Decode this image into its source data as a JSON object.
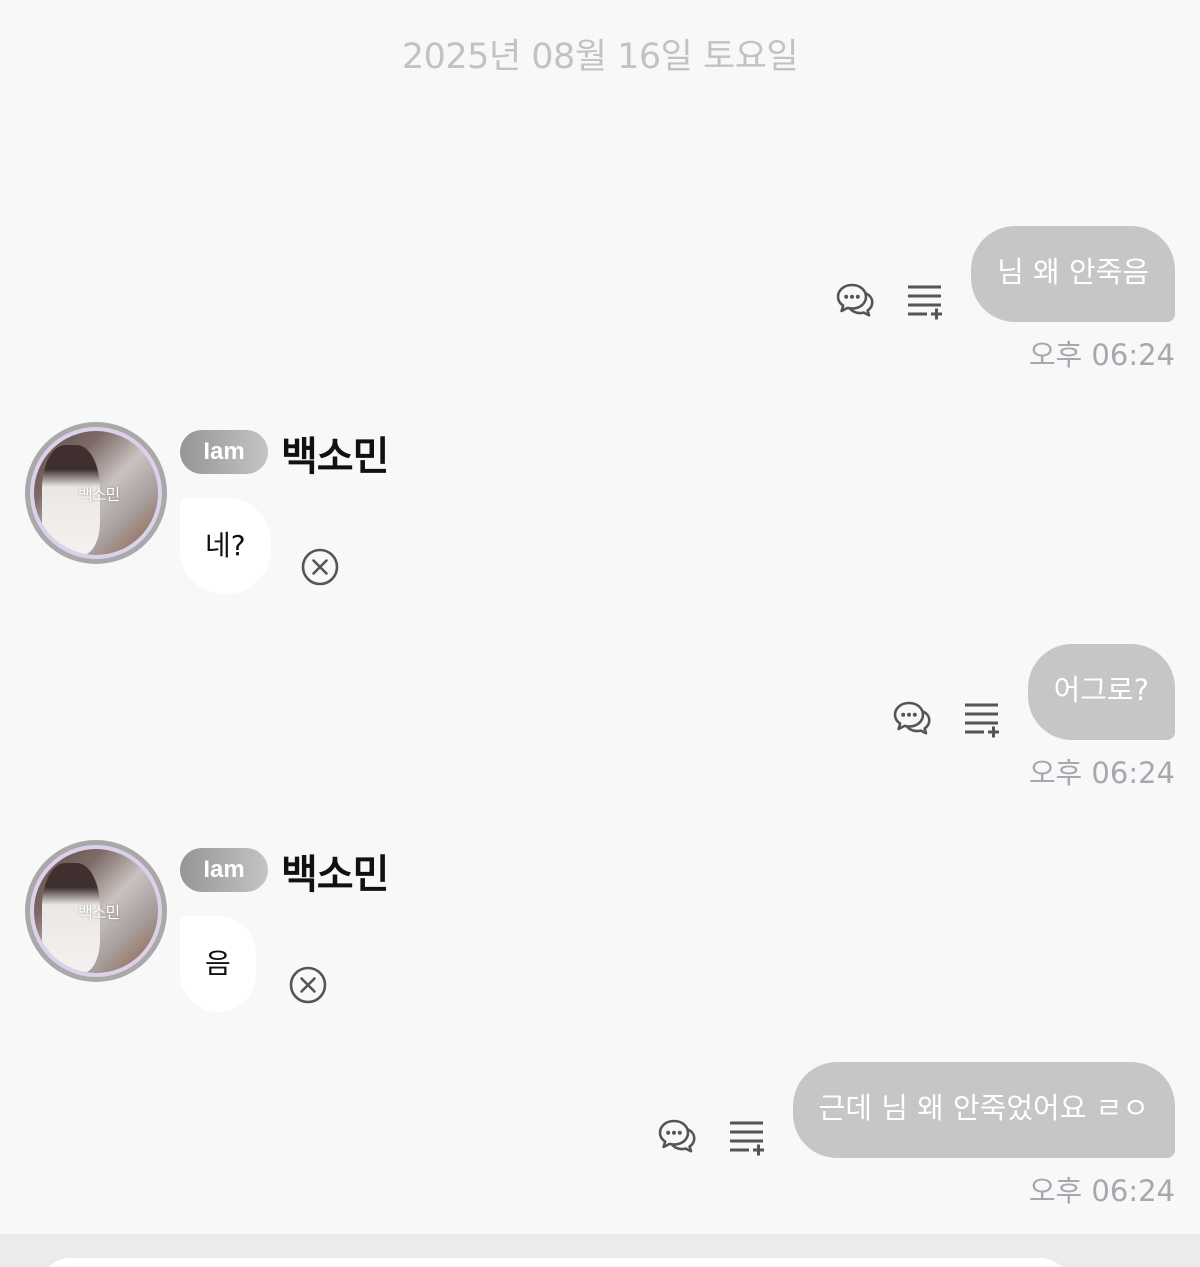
{
  "date_header": "2025년 08월 16일 토요일",
  "messages": [
    {
      "direction": "outgoing",
      "text": "님 왜 안죽음",
      "time": "오후 06:24",
      "actions": [
        "chat-bubbles-icon",
        "list-add-icon"
      ]
    },
    {
      "direction": "incoming",
      "badge": "Iam",
      "sender": "백소민",
      "avatar_text": "백소민",
      "text": "네?",
      "actions": [
        "cancel-circle-icon"
      ]
    },
    {
      "direction": "outgoing",
      "text": "어그로?",
      "time": "오후 06:24",
      "actions": [
        "chat-bubbles-icon",
        "list-add-icon"
      ]
    },
    {
      "direction": "incoming",
      "badge": "Iam",
      "sender": "백소민",
      "avatar_text": "백소민",
      "text": "음",
      "actions": [
        "cancel-circle-icon"
      ]
    },
    {
      "direction": "outgoing",
      "text": "근데 님 왜 안죽었어요 ㄹㅇ",
      "time": "오후 06:24",
      "actions": [
        "chat-bubbles-icon",
        "list-add-icon"
      ]
    }
  ],
  "colors": {
    "background": "#f8f8f8",
    "outgoing_bubble": "#c6c5c7",
    "incoming_bubble": "#ffffff",
    "timestamp": "#a7a7b0",
    "date_header": "#c2c2c6",
    "icon": "#555555"
  }
}
